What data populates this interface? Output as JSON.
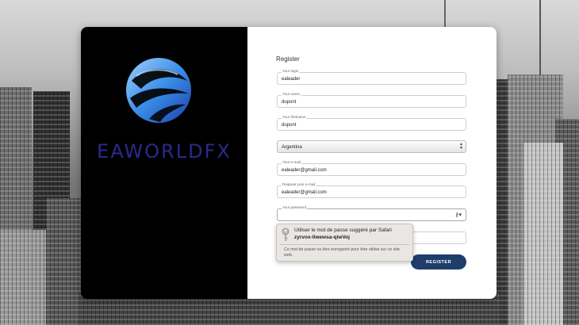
{
  "brand": {
    "name": "EAWORLDFX"
  },
  "form": {
    "title": "Register",
    "login": {
      "label": "Your login",
      "value": "ealeader"
    },
    "name": {
      "label": "Your name",
      "value": "dupont"
    },
    "firstname": {
      "label": "Your firstname",
      "value": "dupont"
    },
    "country": {
      "value": "Argentina"
    },
    "email": {
      "label": "Your e-mail",
      "value": "ealeader@gmail.com"
    },
    "email_repeat": {
      "label": "Reapeat your e-mail",
      "value": "ealeader@gmail.com"
    },
    "password": {
      "label": "Your password",
      "value": ""
    },
    "register_label": "REGISTER"
  },
  "password_suggestion": {
    "line1": "Utiliser le mot de passe suggéré par Safari",
    "password": "zyrvox-0wewsa-qiwVoj",
    "note": "Ce mot de passe va être enregistré pour être utilisé sur ce site web."
  },
  "icons": {
    "select_arrow": "up-down-chevron-icon",
    "password_key": "key-icon",
    "suggestion": "key-icon"
  },
  "colors": {
    "left_panel": "#000000",
    "brand_text": "#2a2a8c",
    "button": "#1e3d6b"
  }
}
